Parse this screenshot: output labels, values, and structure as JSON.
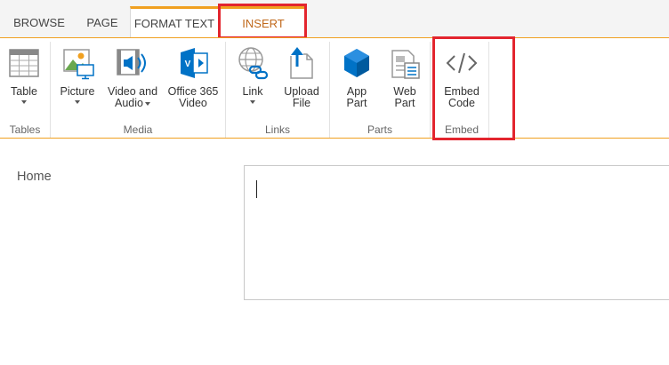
{
  "tabs": [
    {
      "label": "BROWSE"
    },
    {
      "label": "PAGE"
    },
    {
      "label": "FORMAT TEXT"
    },
    {
      "label": "INSERT"
    }
  ],
  "active_tab": "INSERT",
  "ribbon": {
    "tables": {
      "group_label": "Tables",
      "table_label": "Table"
    },
    "media": {
      "group_label": "Media",
      "picture_label": "Picture",
      "video_audio_line1": "Video and",
      "video_audio_line2": "Audio",
      "office365_line1": "Office 365",
      "office365_line2": "Video"
    },
    "links": {
      "group_label": "Links",
      "link_label": "Link",
      "upload_line1": "Upload",
      "upload_line2": "File"
    },
    "parts": {
      "group_label": "Parts",
      "app_line1": "App",
      "app_line2": "Part",
      "web_line1": "Web",
      "web_line2": "Part"
    },
    "embed": {
      "group_label": "Embed",
      "embed_line1": "Embed",
      "embed_line2": "Code"
    }
  },
  "content": {
    "home_label": "Home"
  },
  "colors": {
    "accent": "#f0a020",
    "highlight": "#e3252e",
    "active_tab_text": "#c0681a"
  }
}
